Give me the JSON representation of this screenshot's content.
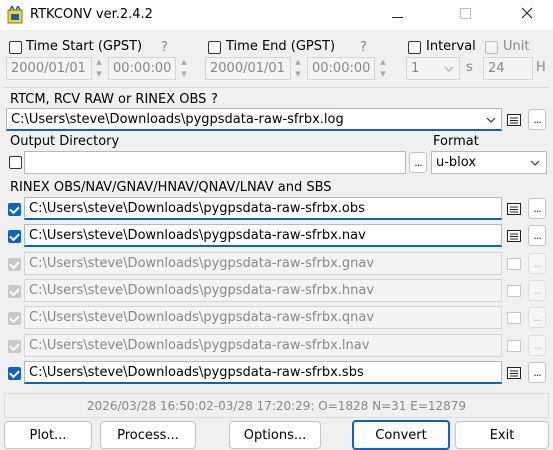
{
  "window": {
    "title": "RTKCONV ver.2.4.2"
  },
  "time": {
    "start_label": "Time Start (GPST)",
    "start_help": "?",
    "start_date": "2000/01/01",
    "start_time": "00:00:00",
    "end_label": "Time End (GPST)",
    "end_help": "?",
    "end_date": "2000/01/01",
    "end_time": "00:00:00",
    "interval_label": "Interval",
    "interval_value": "1",
    "interval_unit": "s",
    "unit_label": "Unit",
    "unit_value": "24",
    "unit_suffix": "H"
  },
  "input": {
    "label": "RTCM, RCV RAW or RINEX OBS",
    "help": "?",
    "path": "C:\\Users\\steve\\Downloads\\pygpsdata-raw-sfrbx.log"
  },
  "output_dir": {
    "label": "Output Directory",
    "value": ""
  },
  "format": {
    "label": "Format",
    "value": "u-blox"
  },
  "outputs": {
    "label": "RINEX OBS/NAV/GNAV/HNAV/QNAV/LNAV and SBS",
    "files": [
      {
        "path": "C:\\Users\\steve\\Downloads\\pygpsdata-raw-sfrbx.obs",
        "checked": true,
        "enabled": true
      },
      {
        "path": "C:\\Users\\steve\\Downloads\\pygpsdata-raw-sfrbx.nav",
        "checked": true,
        "enabled": true
      },
      {
        "path": "C:\\Users\\steve\\Downloads\\pygpsdata-raw-sfrbx.gnav",
        "checked": true,
        "enabled": false
      },
      {
        "path": "C:\\Users\\steve\\Downloads\\pygpsdata-raw-sfrbx.hnav",
        "checked": true,
        "enabled": false
      },
      {
        "path": "C:\\Users\\steve\\Downloads\\pygpsdata-raw-sfrbx.qnav",
        "checked": true,
        "enabled": false
      },
      {
        "path": "C:\\Users\\steve\\Downloads\\pygpsdata-raw-sfrbx.lnav",
        "checked": true,
        "enabled": false
      },
      {
        "path": "C:\\Users\\steve\\Downloads\\pygpsdata-raw-sfrbx.sbs",
        "checked": true,
        "enabled": true
      }
    ]
  },
  "status": "2026/03/28 16:50:02-03/28 17:20:29: O=1828 N=31 E=12879",
  "buttons": {
    "plot": "Plot...",
    "process": "Process...",
    "options": "Options...",
    "convert": "Convert",
    "exit": "Exit",
    "browse": "..."
  },
  "colors": {
    "accent": "#0a64c8",
    "window_bg": "#f0f0f0"
  },
  "icons": {
    "app": "rtkconv-app-icon",
    "minimize": "minimize-icon",
    "maximize": "maximize-icon",
    "close": "close-icon",
    "view": "view-file-icon",
    "dropdown": "chevron-down-icon"
  }
}
